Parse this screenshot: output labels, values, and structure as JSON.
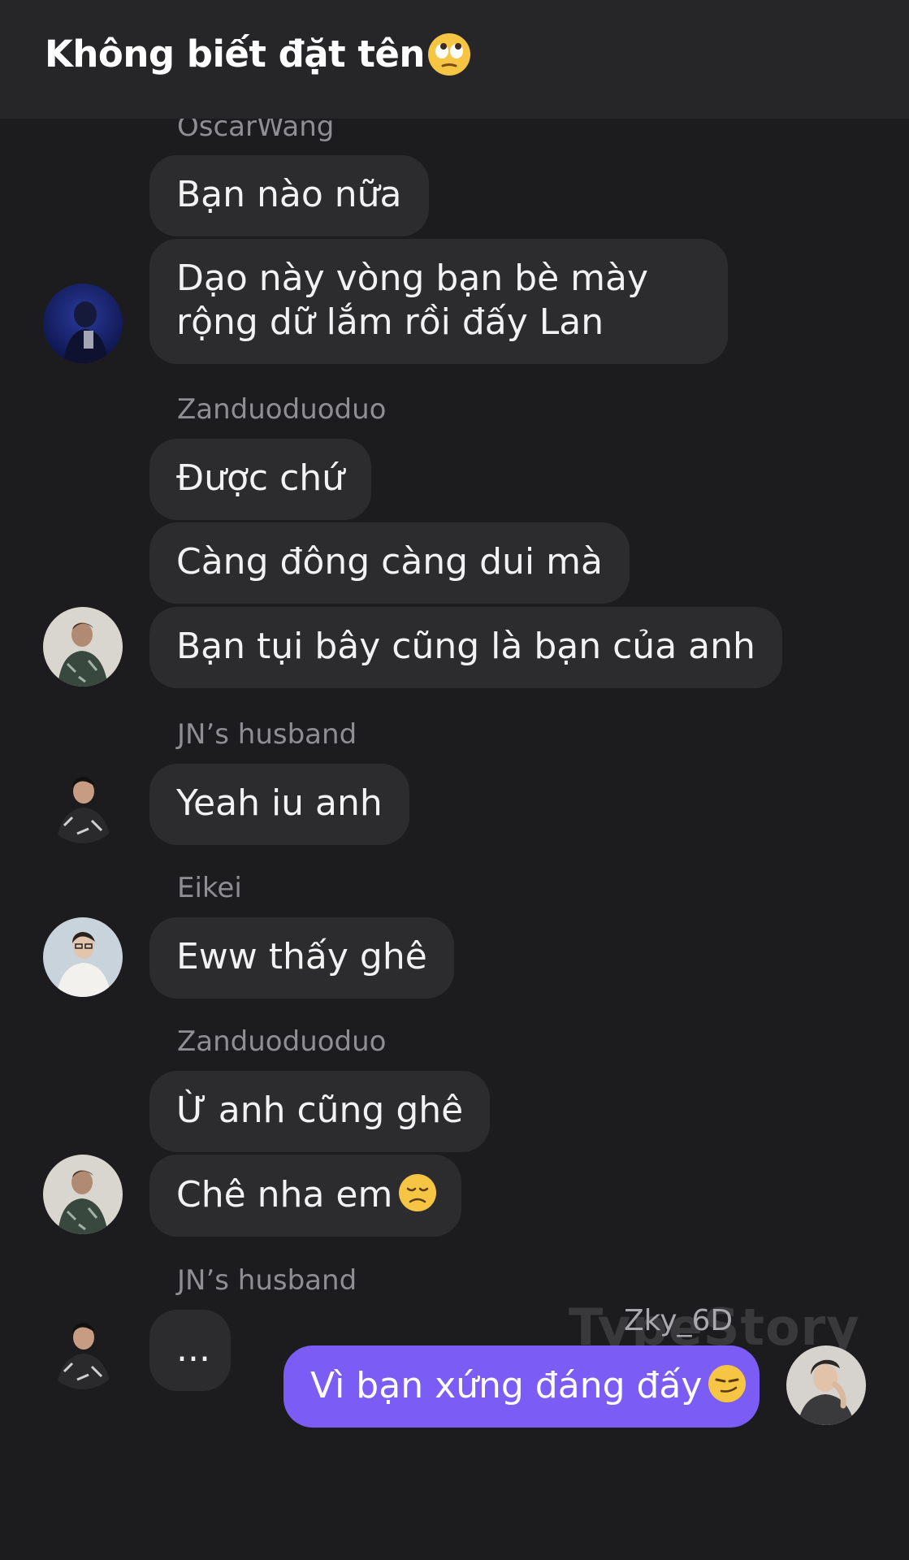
{
  "header": {
    "title": "Không biết đặt tên",
    "title_emoji": "face-with-rolling-eyes-icon"
  },
  "messages": [
    {
      "sender": "OscarWang",
      "bubbles": [
        "Bạn nào nữa",
        "Dạo này vòng bạn bè mày rộng dữ lắm rồi đấy Lan"
      ]
    },
    {
      "sender": "Zanduoduoduo",
      "bubbles": [
        "Được chứ",
        "Càng đông càng dui mà",
        "Bạn tụi bây cũng là bạn của anh"
      ]
    },
    {
      "sender": "JN’s husband",
      "bubbles": [
        "Yeah iu anh"
      ]
    },
    {
      "sender": "Eikei",
      "bubbles": [
        "Eww thấy ghê"
      ]
    },
    {
      "sender": "Zanduoduoduo",
      "bubbles": [
        "Ừ anh cũng ghê",
        "Chê nha em"
      ],
      "bubble_2_emoji": "disappointed-face-icon"
    },
    {
      "sender": "JN’s husband",
      "bubbles": [
        "..."
      ]
    }
  ],
  "outgoing": {
    "sender": "Zky_6D",
    "text": "Vì bạn xứng đáng đấy",
    "emoji": "smirking-face-icon"
  },
  "watermark": "TypeStory",
  "colors": {
    "background": "#1c1c1e",
    "header": "#262628",
    "incoming_bubble": "#2c2c2e",
    "outgoing_bubble": "#7b5cf5",
    "sender_name": "#8e8e93"
  }
}
